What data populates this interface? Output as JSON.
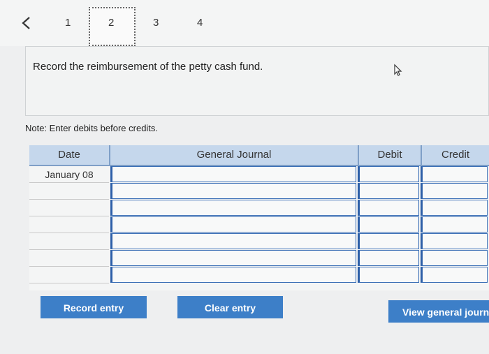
{
  "nav": {
    "steps": [
      "1",
      "2",
      "3",
      "4"
    ]
  },
  "question": {
    "text": "Record the reimbursement of the petty cash fund."
  },
  "note": "Note: Enter debits before credits.",
  "journal": {
    "headers": {
      "date": "Date",
      "general_journal": "General Journal",
      "debit": "Debit",
      "credit": "Credit"
    },
    "rows": [
      {
        "date": "January 08"
      },
      {
        "date": ""
      },
      {
        "date": ""
      },
      {
        "date": ""
      },
      {
        "date": ""
      },
      {
        "date": ""
      },
      {
        "date": ""
      }
    ]
  },
  "buttons": {
    "record": "Record entry",
    "clear": "Clear entry",
    "view": "View general journ"
  }
}
